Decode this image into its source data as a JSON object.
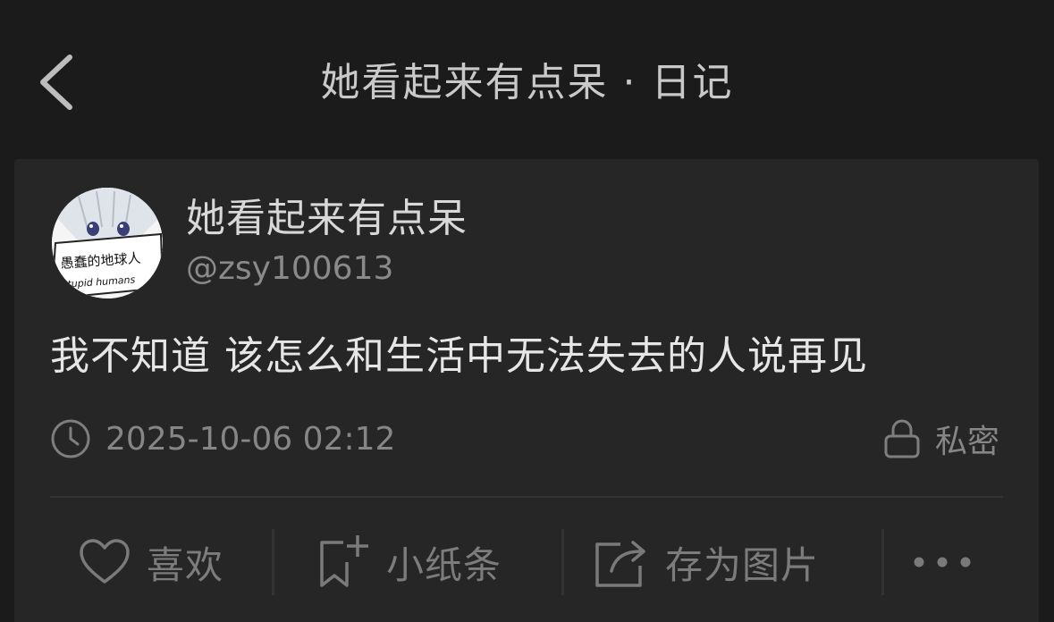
{
  "header": {
    "title": "她看起来有点呆 · 日记"
  },
  "user": {
    "nickname": "她看起来有点呆",
    "handle": "@zsy100613",
    "avatar_sign_line1": "愚蠢的地球人",
    "avatar_sign_line2": "stupid humans"
  },
  "post": {
    "content": "我不知道 该怎么和生活中无法失去的人说再见",
    "datetime": "2025-10-06 02:12",
    "privacy": "私密"
  },
  "actions": {
    "like": "喜欢",
    "note": "小纸条",
    "save_image": "存为图片"
  },
  "icons": {
    "back": "chevron-left-icon",
    "clock": "clock-icon",
    "lock": "lock-icon",
    "heart": "heart-icon",
    "note": "note-add-icon",
    "share": "share-icon",
    "more": "more-icon"
  },
  "colors": {
    "background": "#1b1b1b",
    "card": "#262626",
    "text_primary": "#e6e6e6",
    "text_secondary": "#868686"
  }
}
